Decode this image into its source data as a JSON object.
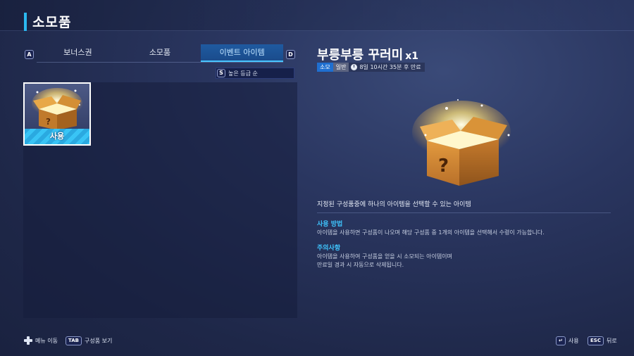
{
  "header": {
    "title": "소모품"
  },
  "tabs": {
    "left_key": "A",
    "right_key": "D",
    "items": [
      {
        "label": "보너스권"
      },
      {
        "label": "소모품"
      },
      {
        "label": "이벤트 아이템"
      }
    ],
    "active_index": 2
  },
  "sort": {
    "key": "S",
    "label": "높은 등급 순"
  },
  "grid": {
    "items": [
      {
        "icon": "mystery-box-icon",
        "action_label": "사용"
      }
    ]
  },
  "detail": {
    "name": "부릉부릉 꾸러미",
    "qty": "x1",
    "tag_type": "소모",
    "tag_grade": "일반",
    "expire": "8일 10시간 35분 후 만료",
    "description": "지정된 구성품중에 하나의 아이템을 선택할 수 있는 아이템",
    "usage_title": "사용 방법",
    "usage_text": "아이템을 사용하면 구성품이 나오며 해당 구성품 중 1개의 아이템을 선택해서 수령이 가능합니다.",
    "caution_title": "주의사항",
    "caution_line1": "아이템을 사용하여 구성품을 얻을 시 소모되는 아이템이며",
    "caution_line2": "만료일 경과 시 자동으로 삭제됩니다."
  },
  "footer": {
    "move_label": "메뉴 이동",
    "tab_key": "TAB",
    "components_label": "구성품 보기",
    "use_label": "사용",
    "esc_key": "ESC",
    "back_label": "뒤로"
  },
  "colors": {
    "accent": "#2bb8f0",
    "active_tab": "#1f5aa0",
    "tag_blue": "#1f6fd0",
    "section_title": "#3fc6ff"
  }
}
